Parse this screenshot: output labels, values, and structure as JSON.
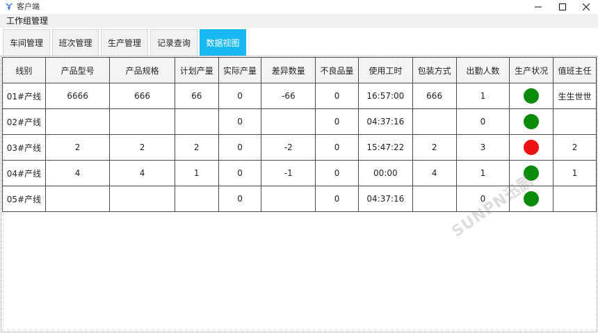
{
  "window": {
    "title": "客户端"
  },
  "menubar": {
    "items": [
      "工作组管理"
    ]
  },
  "tabs": [
    {
      "label": "车间管理",
      "active": false
    },
    {
      "label": "班次管理",
      "active": false
    },
    {
      "label": "生产管理",
      "active": false
    },
    {
      "label": "记录查询",
      "active": false
    },
    {
      "label": "数据视图",
      "active": true
    }
  ],
  "table": {
    "columns": [
      "线别",
      "产品型号",
      "产品规格",
      "计划产量",
      "实际产量",
      "差异数量",
      "不良品量",
      "使用工时",
      "包装方式",
      "出勤人数",
      "生产状况",
      "值班主任"
    ],
    "rows": [
      {
        "cells": [
          "01#产线",
          "6666",
          "666",
          "66",
          "0",
          "-66",
          "0",
          "16:57:00",
          "666",
          "1",
          "",
          "生生世世"
        ],
        "status": "green"
      },
      {
        "cells": [
          "02#产线",
          "",
          "",
          "",
          "0",
          "",
          "0",
          "04:37:16",
          "",
          "0",
          "",
          ""
        ],
        "status": "green"
      },
      {
        "cells": [
          "03#产线",
          "2",
          "2",
          "2",
          "0",
          "-2",
          "0",
          "15:47:22",
          "2",
          "3",
          "",
          "2"
        ],
        "status": "red"
      },
      {
        "cells": [
          "04#产线",
          "4",
          "4",
          "1",
          "0",
          "-1",
          "0",
          "00:00",
          "4",
          "1",
          "",
          "1"
        ],
        "status": "green"
      },
      {
        "cells": [
          "05#产线",
          "",
          "",
          "",
          "0",
          "",
          "0",
          "04:37:16",
          "",
          "0",
          "",
          ""
        ],
        "status": "green"
      }
    ]
  },
  "colors": {
    "accent": "#18b8f2",
    "status_green": "#0a8a0a",
    "status_red": "#ee1111"
  },
  "watermark": "SUNPN迅鹏"
}
